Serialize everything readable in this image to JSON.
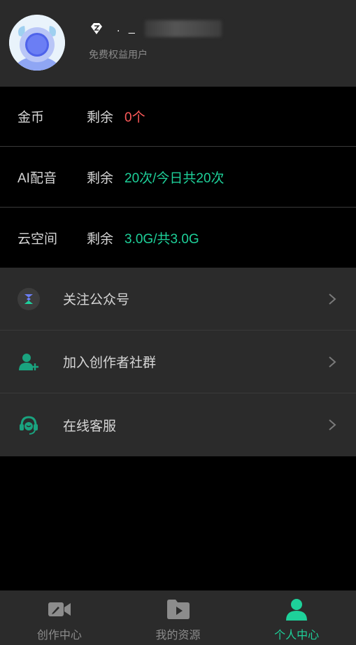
{
  "profile": {
    "username": ". _",
    "user_type": "免费权益用户",
    "avatar_icon": "avatar-icon",
    "vip_icon": "vip-badge-icon"
  },
  "quotas": [
    {
      "label": "金币",
      "remain_label": "剩余",
      "value": "0个",
      "color": "#ff5a5a"
    },
    {
      "label": "AI配音",
      "remain_label": "剩余",
      "value": "20次/今日共20次",
      "color": "#1ed19a"
    },
    {
      "label": "云空间",
      "remain_label": "剩余",
      "value": "3.0G/共3.0G",
      "color": "#1ed19a"
    }
  ],
  "menu": [
    {
      "label": "关注公众号",
      "icon": "wechat-official-account-icon"
    },
    {
      "label": "加入创作者社群",
      "icon": "add-user-icon"
    },
    {
      "label": "在线客服",
      "icon": "headset-icon"
    }
  ],
  "tabs": [
    {
      "label": "创作中心",
      "icon": "video-camera-icon",
      "active": false
    },
    {
      "label": "我的资源",
      "icon": "folder-play-icon",
      "active": false
    },
    {
      "label": "个人中心",
      "icon": "person-icon",
      "active": true
    }
  ],
  "colors": {
    "accent": "#1ed19a",
    "warn": "#ff5a5a",
    "background": "#000000",
    "panel": "#2b2b2b"
  }
}
